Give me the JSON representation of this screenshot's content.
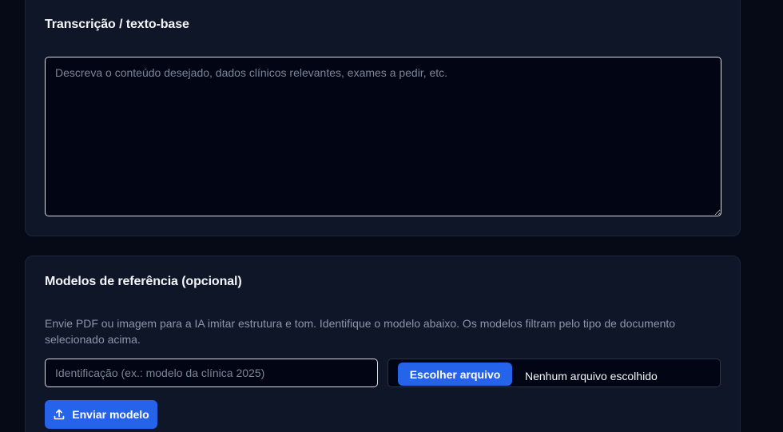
{
  "transcription": {
    "title": "Transcrição / texto-base",
    "placeholder": "Descreva o conteúdo desejado, dados clínicos relevantes, exames a pedir, etc."
  },
  "reference_models": {
    "title": "Modelos de referência (opcional)",
    "description": "Envie PDF ou imagem para a IA imitar estrutura e tom. Identifique o modelo abaixo. Os modelos filtram pelo tipo de documento selecionado acima.",
    "identification_placeholder": "Identificação (ex.: modelo da clínica 2025)",
    "choose_file_label": "Escolher arquivo",
    "no_file_label": "Nenhum arquivo escolhido",
    "send_button_label": "Enviar modelo",
    "send_icon": "upload-icon"
  },
  "colors": {
    "background": "#050a16",
    "card": "#0e1628",
    "accent": "#2563eb"
  }
}
